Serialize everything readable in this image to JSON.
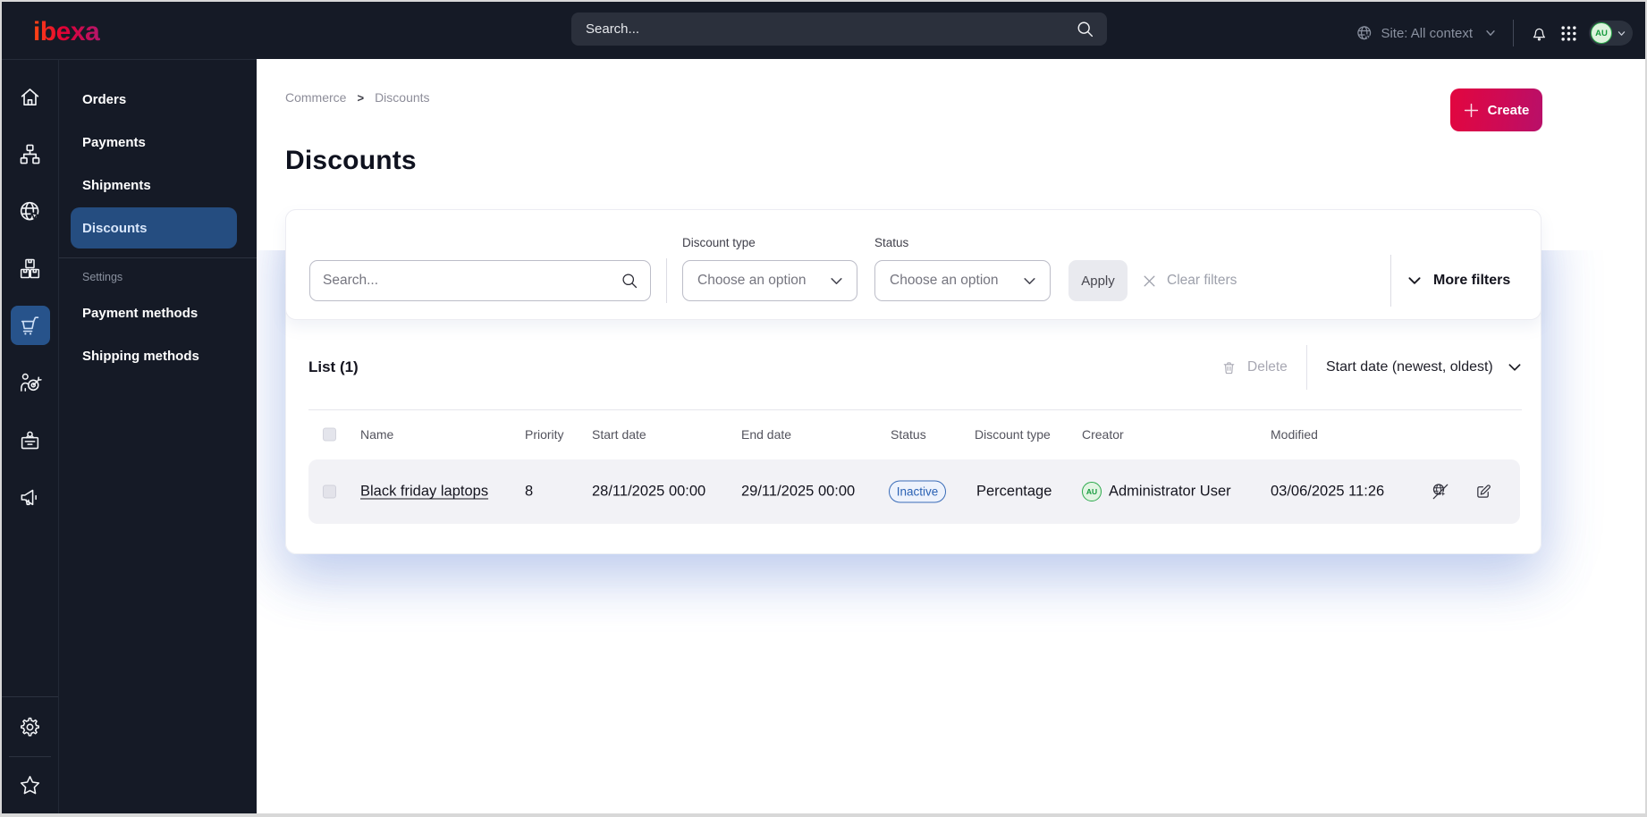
{
  "topbar": {
    "logo": "ibexa",
    "search_placeholder": "Search...",
    "site_context_label": "Site: All context",
    "avatar_initials": "AU"
  },
  "icon_rail": {
    "items": [
      {
        "icon": "home"
      },
      {
        "icon": "content-tree"
      },
      {
        "icon": "site"
      },
      {
        "icon": "products"
      },
      {
        "icon": "commerce-cart",
        "active": true
      },
      {
        "icon": "personalization"
      },
      {
        "icon": "badge"
      },
      {
        "icon": "promotions"
      }
    ],
    "bottom": [
      {
        "icon": "settings-gear"
      },
      {
        "icon": "bookmarks-star"
      }
    ]
  },
  "sidebar": {
    "items": [
      {
        "label": "Orders"
      },
      {
        "label": "Payments"
      },
      {
        "label": "Shipments"
      },
      {
        "label": "Discounts",
        "active": true
      }
    ],
    "section_label": "Settings",
    "settings_items": [
      {
        "label": "Payment methods"
      },
      {
        "label": "Shipping methods"
      }
    ]
  },
  "breadcrumb": {
    "items": [
      "Commerce",
      "Discounts"
    ],
    "separator": ">"
  },
  "page": {
    "title": "Discounts",
    "create_label": "Create"
  },
  "filters": {
    "search_placeholder": "Search...",
    "discount_type_label": "Discount type",
    "discount_type_value": "Choose an option",
    "status_label": "Status",
    "status_value": "Choose an option",
    "apply_label": "Apply",
    "clear_label": "Clear filters",
    "more_filters_label": "More filters"
  },
  "list": {
    "title": "List (1)",
    "delete_label": "Delete",
    "sort_label": "Start date (newest, oldest)",
    "columns": [
      "Name",
      "Priority",
      "Start date",
      "End date",
      "Status",
      "Discount type",
      "Creator",
      "Modified"
    ],
    "rows": [
      {
        "name": "Black friday laptops",
        "priority": "8",
        "start_date": "28/11/2025 00:00",
        "end_date": "29/11/2025 00:00",
        "status": "Inactive",
        "discount_type": "Percentage",
        "creator": "Administrator User",
        "creator_initials": "AU",
        "modified": "03/06/2025 11:26"
      }
    ]
  },
  "colors": {
    "topbar_bg": "#151a26",
    "active_nav_blue": "#254d80",
    "brand_gradient": [
      "#ff4713",
      "#e00034",
      "#b4176c"
    ],
    "create_gradient": [
      "#e2063f",
      "#b81069"
    ],
    "status_badge_blue": "#2b62b4",
    "avatar_green": "#2aa84a"
  }
}
